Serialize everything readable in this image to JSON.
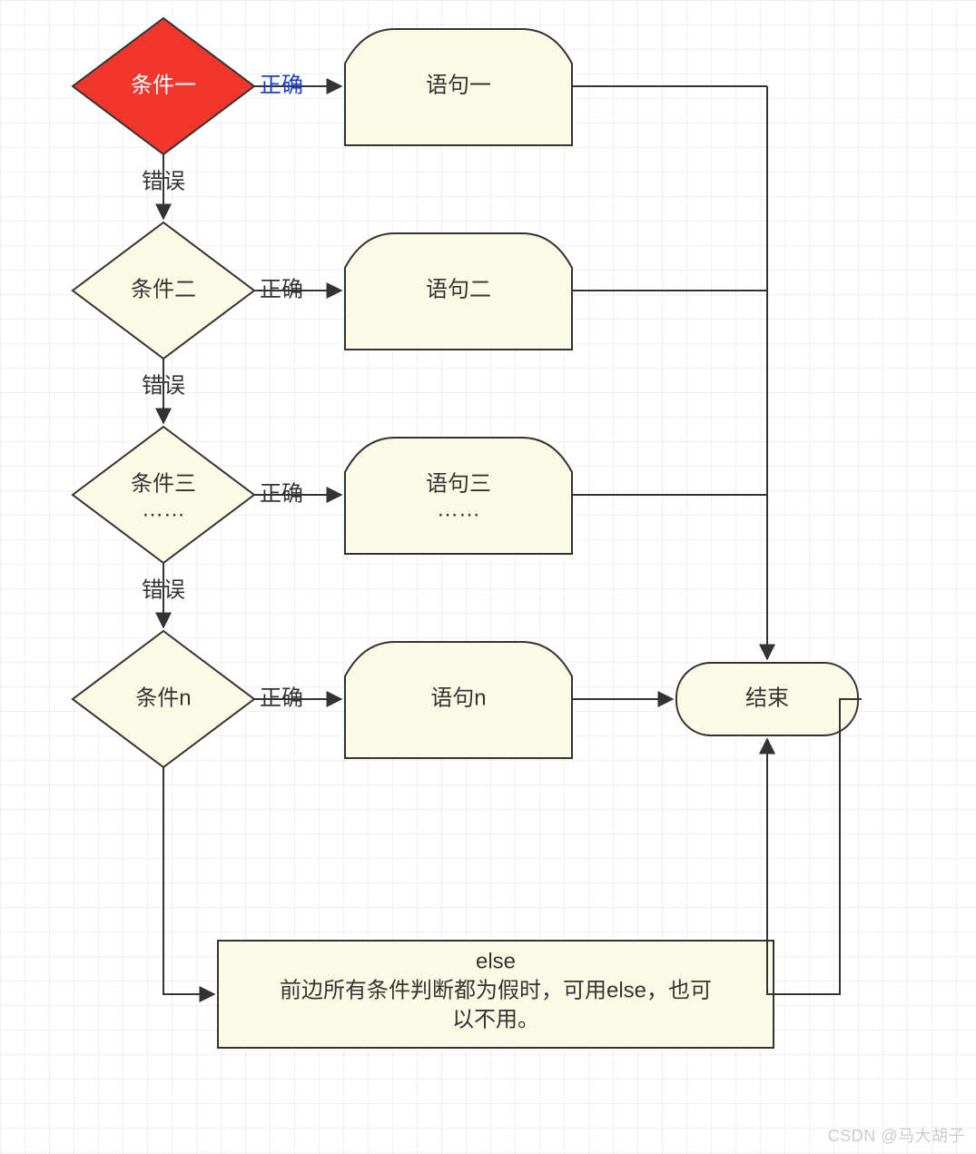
{
  "diagram": {
    "nodes": {
      "cond1": "条件一",
      "cond2": "条件二",
      "cond3_l1": "条件三",
      "cond3_l2": "……",
      "condn": "条件n",
      "stmt1": "语句一",
      "stmt2": "语句二",
      "stmt3_l1": "语句三",
      "stmt3_l2": "……",
      "stmtn": "语句n",
      "end": "结束",
      "else_l1": "else",
      "else_l2": "前边所有条件判断都为假时，可用else，也可",
      "else_l3": "以不用。"
    },
    "edges": {
      "true1": "正确",
      "false1": "错误",
      "true2": "正确",
      "false2": "错误",
      "true3": "正确",
      "false3": "错误",
      "truen": "正确"
    },
    "colors": {
      "highlight_fill": "#f0362d",
      "node_fill": "#fbfbe5",
      "node_stroke": "#333333",
      "grid": "#eef0f2"
    }
  },
  "watermark": "CSDN @马大胡子"
}
